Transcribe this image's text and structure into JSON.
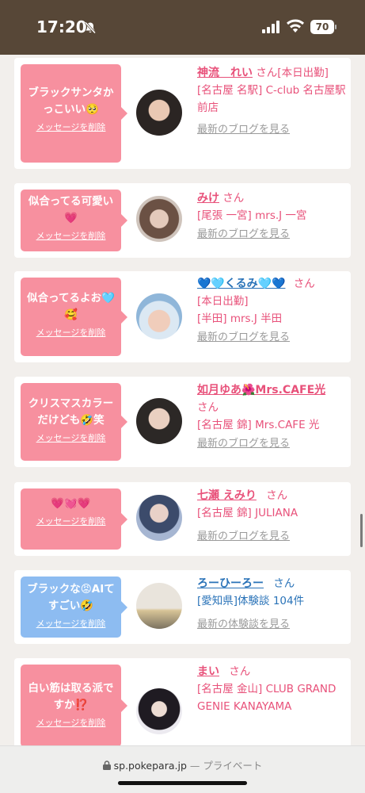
{
  "status": {
    "time": "17:20",
    "battery": "70"
  },
  "cards": [
    {
      "message": "ブラックサンタかっこいい🥺",
      "delete": "メッセージを削除",
      "name": "神流　れい",
      "san": "さん",
      "lines": [
        "[本日出勤]",
        "[名古屋 名駅] C-club 名古屋駅前店"
      ],
      "link": "最新のブログを見る"
    },
    {
      "message": "似合ってる可愛い💗",
      "delete": "メッセージを削除",
      "name": "みけ",
      "san": "さん",
      "lines": [
        "[尾張 一宮] mrs.J 一宮"
      ],
      "link": "最新のブログを見る"
    },
    {
      "message": "似合ってるよお🩵🥰",
      "delete": "メッセージを削除",
      "name": "💙🩵くるみ🩵💙",
      "san": "さん",
      "lines": [
        "[本日出勤]",
        "[半田] mrs.J 半田"
      ],
      "link": "最新のブログを見る"
    },
    {
      "message": "クリスマスカラーだけども🤣笑",
      "delete": "メッセージを削除",
      "name": "如月ゆあ🌺Mrs.CAFE光",
      "san": "さん",
      "lines": [
        "[名古屋 錦] Mrs.CAFE 光"
      ],
      "link": "最新のブログを見る"
    },
    {
      "message": "💗💓💗",
      "delete": "メッセージを削除",
      "name": "七瀬 えみり",
      "san": "さん",
      "lines": [
        "[名古屋 錦] JULIANA"
      ],
      "link": "最新のブログを見る"
    },
    {
      "message": "ブラックな😡AIてすごい🤣",
      "delete": "メッセージを削除",
      "name": "ろーひーろー",
      "san": "さん",
      "lines": [
        "[愛知県]体験談 104件"
      ],
      "link": "最新の体験談を見る"
    },
    {
      "message": "白い筋は取る派ですか⁉️",
      "delete": "メッセージを削除",
      "name": "まい",
      "san": "さん",
      "lines": [
        "[名古屋 金山] CLUB GRAND GENIE KANAYAMA"
      ],
      "link": ""
    }
  ],
  "browser": {
    "domain": "sp.pokepara.jp",
    "privacy": " — プライベート"
  },
  "colors": {
    "statusbar": "#574737",
    "pink": "#f7909f",
    "blue": "#8dbcf1",
    "name_pink": "#e8517a",
    "name_blue": "#2a73b8"
  }
}
